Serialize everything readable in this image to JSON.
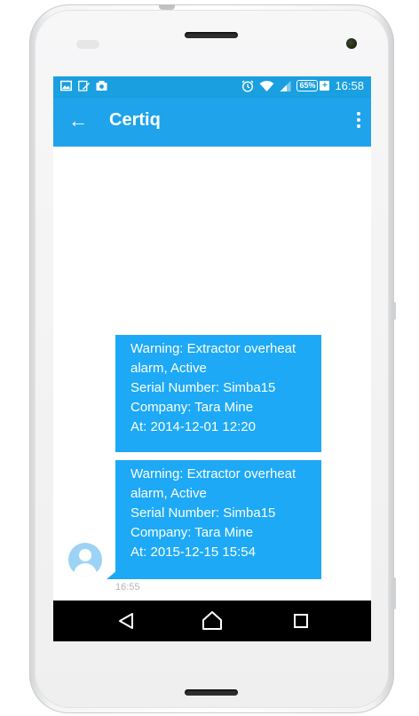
{
  "status_bar": {
    "left_icons": [
      "gallery-icon",
      "edit-note-icon",
      "camera-icon"
    ],
    "right_icons": [
      "alarm-icon",
      "wifi-icon",
      "signal-icon"
    ],
    "battery_percent": "65%",
    "battery_plus": "+",
    "time": "16:58"
  },
  "app_bar": {
    "back_icon": "arrow-left-icon",
    "title": "Certiq",
    "menu_icon": "more-vert-icon"
  },
  "messages": [
    {
      "lines": [
        "Warning: Extractor overheat",
        "alarm, Active",
        "Serial Number: Simba15",
        "Company: Tara Mine",
        "At: 2014-12-01 12:20"
      ]
    },
    {
      "lines": [
        "Warning: Extractor overheat",
        "alarm, Active",
        "Serial Number: Simba15",
        "Company: Tara Mine",
        "At: 2015-12-15 15:54"
      ]
    }
  ],
  "last_message_time": "16:55",
  "colors": {
    "status_bar": "#1a9fe0",
    "app_bar": "#1fa3ea",
    "bubble": "#1da9f5",
    "avatar": "#9cd3f5",
    "nav_bar": "#000000"
  },
  "nav_bar": {
    "buttons": [
      "back-triangle-icon",
      "home-icon",
      "recents-icon"
    ]
  }
}
